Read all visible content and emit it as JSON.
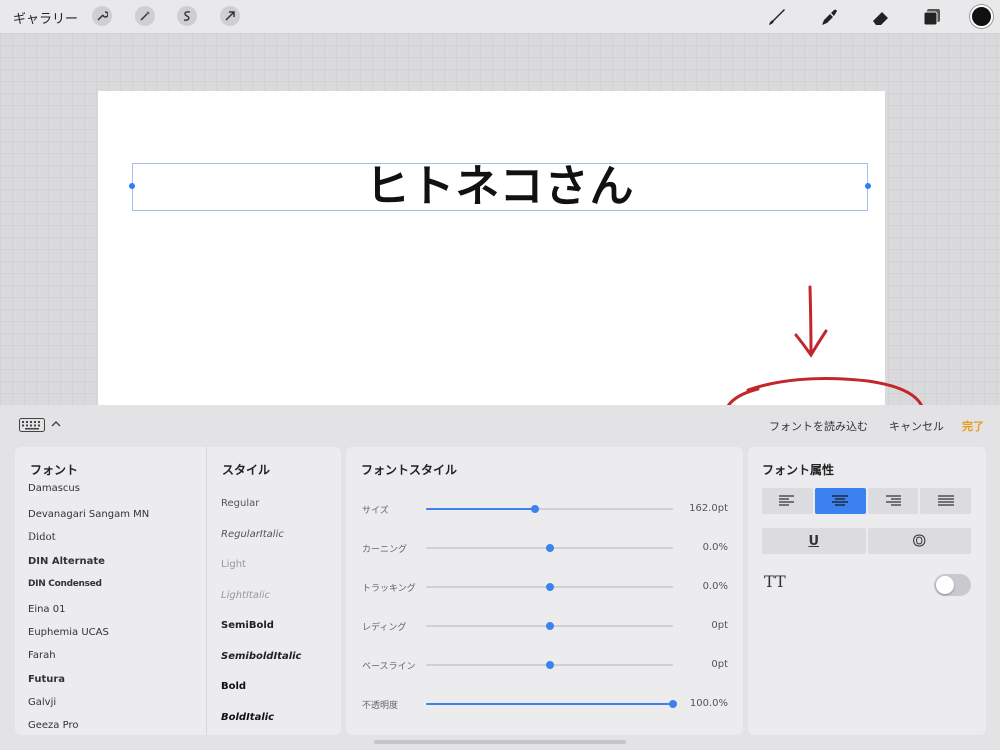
{
  "topbar": {
    "gallery_label": "ギャラリー",
    "left_tools": [
      "wrench-icon",
      "magic-wand-icon",
      "selection-icon",
      "move-arrow-icon"
    ],
    "right_tools": [
      "brush-icon",
      "smudge-icon",
      "eraser-icon",
      "layers-icon"
    ],
    "current_color": "#111111"
  },
  "canvas": {
    "text": "ヒトネコさん"
  },
  "panel": {
    "import_font_label": "フォントを読み込む",
    "cancel_label": "キャンセル",
    "done_label": "完了",
    "accent_color": "#3b82f0",
    "done_color": "#e89b1a",
    "font_column": {
      "heading": "フォント",
      "items": [
        "Damascus",
        "Devanagari Sangam MN",
        "Didot",
        "DIN Alternate",
        "DIN Condensed",
        "Eina 01",
        "Euphemia UCAS",
        "Farah",
        "Futura",
        "Galvji",
        "Geeza Pro"
      ]
    },
    "style_column": {
      "heading": "スタイル",
      "items": [
        "Regular",
        "RegularItalic",
        "Light",
        "LightItalic",
        "SemiBold",
        "SemiboldItalic",
        "Bold",
        "BoldItalic"
      ]
    },
    "font_style": {
      "heading": "フォントスタイル",
      "sliders": [
        {
          "label": "サイズ",
          "value": "162.0pt",
          "fraction": 0.44
        },
        {
          "label": "カーニング",
          "value": "0.0%",
          "fraction": 0.5
        },
        {
          "label": "トラッキング",
          "value": "0.0%",
          "fraction": 0.5
        },
        {
          "label": "レディング",
          "value": "0pt",
          "fraction": 0.5
        },
        {
          "label": "ベースライン",
          "value": "0pt",
          "fraction": 0.5
        },
        {
          "label": "不透明度",
          "value": "100.0%",
          "fraction": 1.0
        }
      ]
    },
    "font_attributes": {
      "heading": "フォント属性",
      "alignments": [
        "align-left",
        "align-center",
        "align-right",
        "align-justify"
      ],
      "active_alignment": "align-center",
      "underline_label": "U",
      "outline_label": "O",
      "tt_label": "TT",
      "tt_enabled": false
    }
  }
}
